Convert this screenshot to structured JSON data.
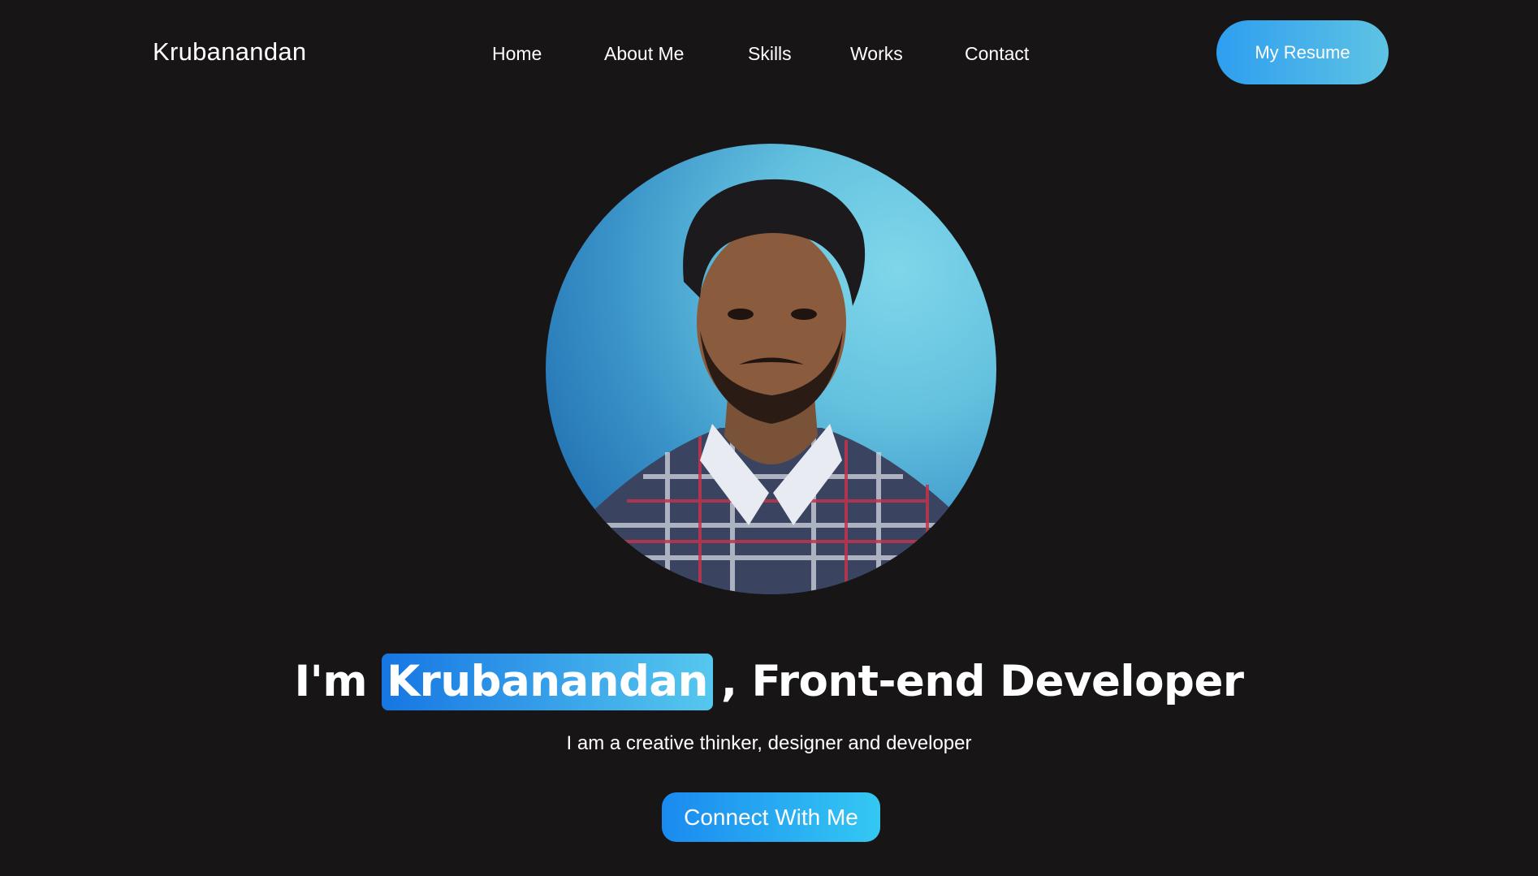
{
  "header": {
    "brand": "Krubanandan",
    "nav": {
      "home": "Home",
      "about": "About Me",
      "skills": "Skills",
      "works": "Works",
      "contact": "Contact"
    },
    "resume_label": "My Resume"
  },
  "hero": {
    "avatar_icon": "profile-photo",
    "intro": "I'm",
    "name": "Krubanandan",
    "role": ", Front-end Developer",
    "subtitle": "I am a creative thinker, designer and developer",
    "cta_label": "Connect With Me"
  },
  "colors": {
    "background": "#171515",
    "accent_start": "#1676e3",
    "accent_end": "#56c8ee"
  }
}
